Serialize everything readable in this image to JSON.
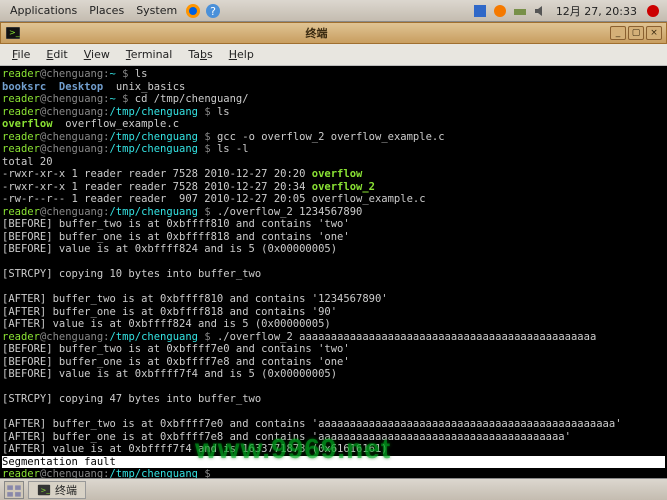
{
  "top_panel": {
    "menus": [
      "Applications",
      "Places",
      "System"
    ],
    "clock": "12月 27, 20:33"
  },
  "window": {
    "title": "终端",
    "menus": [
      {
        "label": "File",
        "access": "F"
      },
      {
        "label": "Edit",
        "access": "E"
      },
      {
        "label": "View",
        "access": "V"
      },
      {
        "label": "Terminal",
        "access": "T"
      },
      {
        "label": "Tabs",
        "access": "b"
      },
      {
        "label": "Help",
        "access": "H"
      }
    ]
  },
  "prompt": {
    "user": "reader",
    "host": "@chenguang",
    "home": "~",
    "dir": "/tmp/chenguang",
    "sep": " $ ",
    "colon": ":"
  },
  "cmd": {
    "ls": "ls",
    "cd": "cd /tmp/chenguang/",
    "ls2": "ls",
    "gcc": "gcc -o overflow_2 overflow_example.c",
    "lsl": "ls -l",
    "run1": "./overflow_2 1234567890",
    "run2": "./overflow_2 aaaaaaaaaaaaaaaaaaaaaaaaaaaaaaaaaaaaaaaaaaaaaaa"
  },
  "ls_home": {
    "d1": "booksrc",
    "d2": "Desktop",
    "f1": "unix_basics"
  },
  "ls_dir": {
    "g1": "overflow",
    "f1": "overflow_example.c"
  },
  "lsl": {
    "total": "total 20",
    "l1a": "-rwxr-xr-x 1 reader reader 7528 2010-12-27 20:20 ",
    "l1b": "overflow",
    "l2a": "-rwxr-xr-x 1 reader reader 7528 2010-12-27 20:34 ",
    "l2b": "overflow_2",
    "l3": "-rw-r--r-- 1 reader reader  907 2010-12-27 20:05 overflow_example.c"
  },
  "run1": {
    "b1": "[BEFORE] buffer_two is at 0xbffff810 and contains 'two'",
    "b2": "[BEFORE] buffer_one is at 0xbffff818 and contains 'one'",
    "b3": "[BEFORE] value is at 0xbffff824 and is 5 (0x00000005)",
    "cp": "[STRCPY] copying 10 bytes into buffer_two",
    "a1": "[AFTER] buffer_two is at 0xbffff810 and contains '1234567890'",
    "a2": "[AFTER] buffer_one is at 0xbffff818 and contains '90'",
    "a3": "[AFTER] value is at 0xbffff824 and is 5 (0x00000005)"
  },
  "run2": {
    "b1": "[BEFORE] buffer_two is at 0xbffff7e0 and contains 'two'",
    "b2": "[BEFORE] buffer_one is at 0xbffff7e8 and contains 'one'",
    "b3": "[BEFORE] value is at 0xbffff7f4 and is 5 (0x00000005)",
    "cp": "[STRCPY] copying 47 bytes into buffer_two",
    "a1": "[AFTER] buffer_two is at 0xbffff7e0 and contains 'aaaaaaaaaaaaaaaaaaaaaaaaaaaaaaaaaaaaaaaaaaaaaaa'",
    "a2": "[AFTER] buffer_one is at 0xbffff7e8 and contains 'aaaaaaaaaaaaaaaaaaaaaaaaaaaaaaaaaaaaaaa'",
    "a3": "[AFTER] value is at 0xbffff7f4 and is 1633771873 (0x61616161)"
  },
  "segfault": "Segmentation fault",
  "taskbar": {
    "task": "终端"
  },
  "watermark": "www.9969.net"
}
